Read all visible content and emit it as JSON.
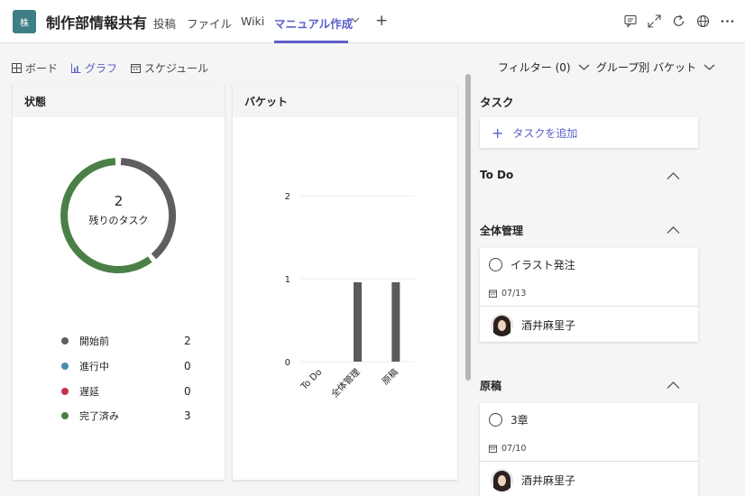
{
  "header": {
    "avatar_text": "株",
    "team_title": "制作部情報共有",
    "tabs": [
      {
        "label": "投稿"
      },
      {
        "label": "ファイル"
      },
      {
        "label": "Wiki"
      },
      {
        "label": "マニュアル作成"
      }
    ],
    "active_tab": "マニュアル作成",
    "icons": [
      "chat-icon",
      "expand-icon",
      "refresh-icon",
      "globe-icon",
      "more-icon"
    ]
  },
  "toolbar": {
    "views": [
      {
        "label": "ボード"
      },
      {
        "label": "グラフ"
      },
      {
        "label": "スケジュール"
      }
    ],
    "active_view": "グラフ",
    "filter_label": "フィルター (0)",
    "group_label": "グループ別 バケット"
  },
  "status_card": {
    "title": "状態",
    "remaining_count": "2",
    "remaining_label": "残りのタスク",
    "legend": [
      {
        "label": "開始前",
        "value": "2",
        "color": "#5f5f5f"
      },
      {
        "label": "進行中",
        "value": "0",
        "color": "#4a8bb0"
      },
      {
        "label": "遅延",
        "value": "0",
        "color": "#c4314b"
      },
      {
        "label": "完了済み",
        "value": "3",
        "color": "#4a7f45"
      }
    ]
  },
  "bucket_card": {
    "title": "バケット"
  },
  "chart_data": {
    "type": "bar",
    "categories": [
      "To Do",
      "全体管理",
      "原稿"
    ],
    "values": [
      0,
      1,
      1
    ],
    "ylim": [
      0,
      2
    ],
    "yticks": [
      "0",
      "1",
      "2"
    ],
    "grid": true,
    "bar_color": "#5c5b59"
  },
  "tasks_panel": {
    "title": "タスク",
    "add_label": "タスクを追加",
    "buckets": [
      {
        "name": "To Do",
        "tasks": []
      },
      {
        "name": "全体管理",
        "tasks": [
          {
            "title": "イラスト発注",
            "date": "07/13",
            "assignee": "酒井麻里子"
          }
        ]
      },
      {
        "name": "原稿",
        "tasks": [
          {
            "title": "3章",
            "date": "07/10",
            "assignee": "酒井麻里子"
          }
        ]
      }
    ]
  }
}
